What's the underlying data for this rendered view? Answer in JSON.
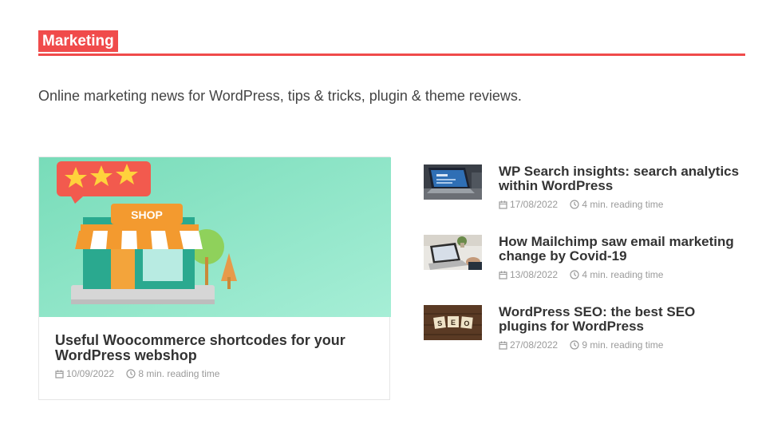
{
  "section": {
    "label": "Marketing",
    "description": "Online marketing news for WordPress, tips & tricks, plugin & theme reviews.",
    "accent_color": "#f04b4b"
  },
  "featured": {
    "title": "Useful Woocommerce shortcodes for your WordPress webshop",
    "date": "10/09/2022",
    "reading_time": "8 min. reading time",
    "image_sign_text": "SHOP"
  },
  "posts": [
    {
      "title": "WP Search insights: search analytics within WordPress",
      "date": "17/08/2022",
      "reading_time": "4 min. reading time"
    },
    {
      "title": "How Mailchimp saw email marketing change by Covid-19",
      "date": "13/08/2022",
      "reading_time": "4 min. reading time"
    },
    {
      "title": "WordPress SEO: the best SEO plugins for WordPress",
      "date": "27/08/2022",
      "reading_time": "9 min. reading time",
      "image_tiles_text": [
        "S",
        "E",
        "O"
      ]
    }
  ],
  "icons": {
    "date": "calendar-icon",
    "reading_time": "clock-icon"
  }
}
